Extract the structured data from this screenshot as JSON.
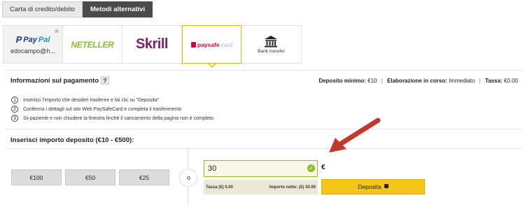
{
  "tabs": [
    {
      "label": "Carta di credito/debito",
      "active": false
    },
    {
      "label": "Metodi alternativi",
      "active": true
    }
  ],
  "methods": {
    "paypal": {
      "brand_a": "Pay",
      "brand_b": "Pal",
      "user": "edocampo@h..."
    },
    "neteller": {
      "brand": "NETELLER"
    },
    "skrill": {
      "brand": "Skrill"
    },
    "paysafecard": {
      "brand_a": "paysafe",
      "brand_b": "card"
    },
    "bank": {
      "label": "Bank transfer"
    }
  },
  "info": {
    "title": "Informazioni sul pagamento",
    "help": "?",
    "min_deposit_label": "Deposito minimo:",
    "min_deposit_value": "€10",
    "processing_label": "Elaborazione in corso:",
    "processing_value": "Immediato",
    "fee_label": "Tassa:",
    "fee_value": "€0.00",
    "separator": "|"
  },
  "steps": [
    {
      "num": "1",
      "text": "Inserisci l'importo che desideri trasferire e fai clic su \"Deposita\""
    },
    {
      "num": "2",
      "text": "Conferma i dettagli sul sito Web PaySafeCard e completa il trasferimento"
    },
    {
      "num": "3",
      "text": "Sii paziente e non chiudere la finestra finché il caricamento della pagina non è completo"
    }
  ],
  "deposit": {
    "title": "Inserisci importo deposito (€10 - €500):",
    "quick_amounts": [
      "€100",
      "€50",
      "€25"
    ],
    "amount_value": "30",
    "currency": "€",
    "fee_text": "Tassa (€) 0.00",
    "net_text": "Importo netto: (€) 30.00",
    "button_label": "Deposita"
  },
  "colors": {
    "accent_yellow": "#f5c518",
    "valid_green": "#8bbf2c",
    "arrow_red": "#c0392b"
  }
}
